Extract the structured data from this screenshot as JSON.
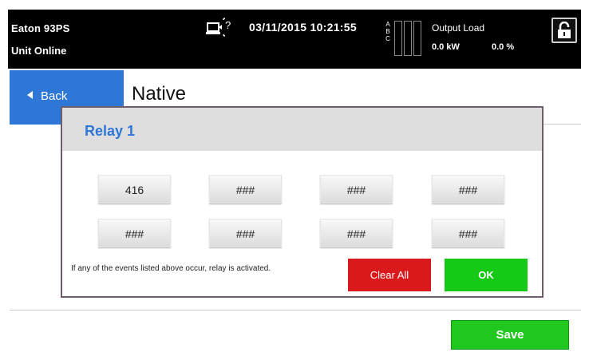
{
  "header": {
    "device_name": "Eaton 93PS",
    "unit_status": "Unit Online",
    "alarm_icon": "alarm-monitor-icon",
    "datetime": "03/11/2015 10:21:55",
    "phases": [
      "A",
      "B",
      "C"
    ],
    "phase_load_fraction": [
      0,
      0,
      0
    ],
    "output_load_label": "Output Load",
    "output_load_kw": "0.0 kW",
    "output_load_pct": "0.0 %",
    "lock_icon": "unlocked-padlock-icon"
  },
  "screen": {
    "back_label": "Back",
    "title": "Native",
    "save_label": "Save"
  },
  "dialog": {
    "title": "Relay 1",
    "events": [
      "416",
      "###",
      "###",
      "###",
      "###",
      "###",
      "###",
      "###"
    ],
    "note": "If any of the events listed above occur, relay is activated.",
    "clear_all_label": "Clear All",
    "ok_label": "OK"
  },
  "colors": {
    "accent_blue": "#2f77d6",
    "ok_green": "#16c916",
    "clear_red": "#d9191b"
  }
}
